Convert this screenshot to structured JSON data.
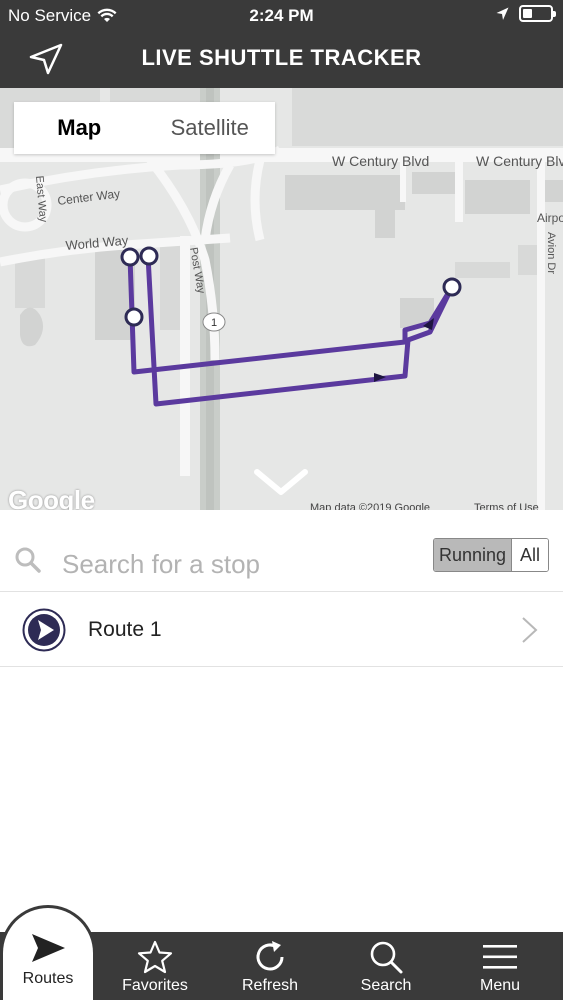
{
  "status_bar": {
    "carrier": "No Service",
    "time": "2:24 PM"
  },
  "header": {
    "title": "LIVE SHUTTLE TRACKER",
    "location_icon": "location-arrow-icon"
  },
  "map": {
    "type_toggle": {
      "map_label": "Map",
      "satellite_label": "Satellite",
      "selected": "Map"
    },
    "street_labels": [
      "W Century Blvd",
      "W Century Blvd",
      "Center Way",
      "World Way",
      "East Way",
      "Post Way",
      "Avion Dr",
      "Airpo",
      "1"
    ],
    "attribution": {
      "logo": "Google",
      "map_data": "Map data ©2019 Google",
      "terms": "Terms of Use"
    },
    "route_color": "#5b3a9e",
    "collapse_icon": "chevron-down-icon"
  },
  "search": {
    "placeholder": "Search for a stop",
    "filter": {
      "running_label": "Running",
      "all_label": "All",
      "selected": "Running"
    }
  },
  "routes": [
    {
      "name": "Route 1",
      "icon": "play-circle-icon"
    }
  ],
  "tab_bar": {
    "tabs": [
      {
        "label": "Routes",
        "icon": "play-icon",
        "active": true
      },
      {
        "label": "Favorites",
        "icon": "star-icon"
      },
      {
        "label": "Refresh",
        "icon": "refresh-icon"
      },
      {
        "label": "Search",
        "icon": "search-icon"
      },
      {
        "label": "Menu",
        "icon": "menu-icon"
      }
    ]
  },
  "colors": {
    "header_bg": "#3a3a3a",
    "route_purple": "#5b3a9e",
    "icon_navy": "#2e2b55"
  }
}
